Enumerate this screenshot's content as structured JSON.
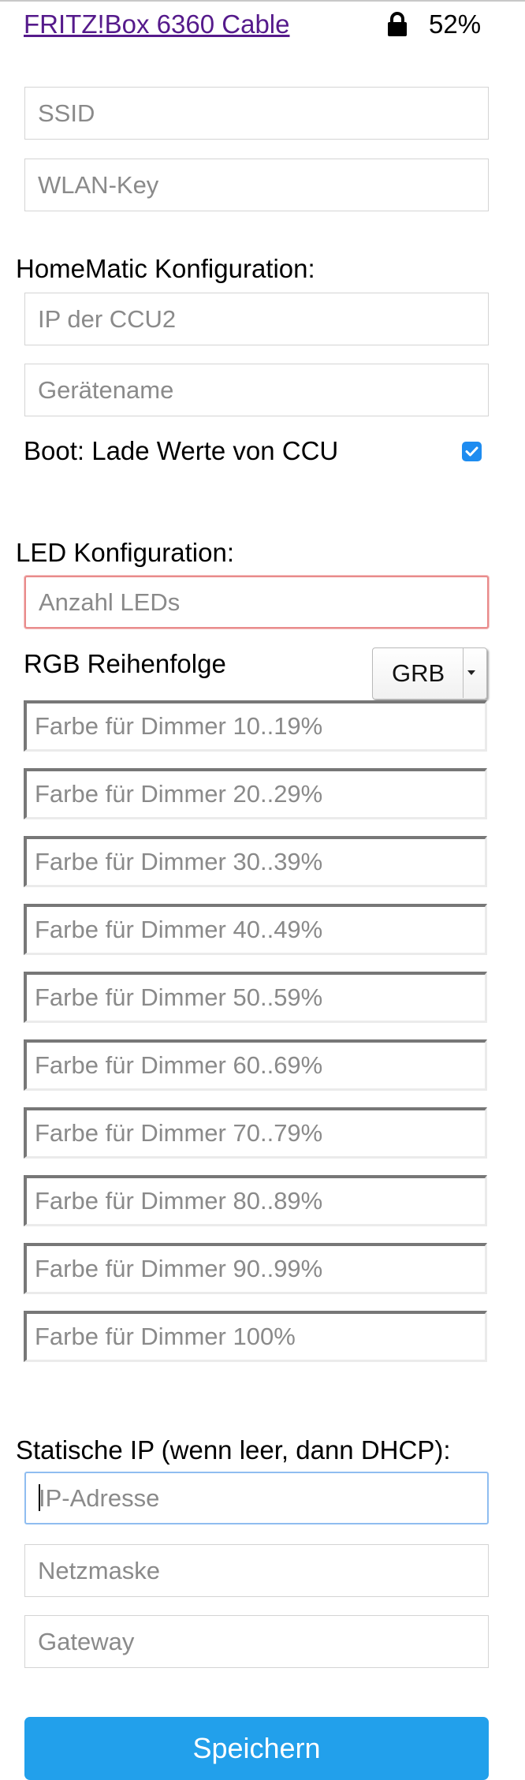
{
  "header": {
    "network_name": "FRITZ!Box 6360 Cable",
    "lock_icon": "lock-icon",
    "signal_strength": "52%"
  },
  "wifi": {
    "ssid_placeholder": "SSID",
    "key_placeholder": "WLAN-Key"
  },
  "homematic": {
    "heading": "HomeMatic Konfiguration:",
    "ccu_ip_placeholder": "IP der CCU2",
    "device_name_placeholder": "Gerätename",
    "boot_label": "Boot: Lade Werte von CCU",
    "boot_checked": true
  },
  "led": {
    "heading": "LED Konfiguration:",
    "count_placeholder": "Anzahl LEDs",
    "rgb_order_label": "RGB Reihenfolge",
    "rgb_order_value": "GRB",
    "dimmer_colors": [
      "Farbe für Dimmer 10..19%",
      "Farbe für Dimmer 20..29%",
      "Farbe für Dimmer 30..39%",
      "Farbe für Dimmer 40..49%",
      "Farbe für Dimmer 50..59%",
      "Farbe für Dimmer 60..69%",
      "Farbe für Dimmer 70..79%",
      "Farbe für Dimmer 80..89%",
      "Farbe für Dimmer 90..99%",
      "Farbe für Dimmer 100%"
    ]
  },
  "static_ip": {
    "heading": "Statische IP (wenn leer, dann DHCP):",
    "ip_placeholder": "IP-Adresse",
    "netmask_placeholder": "Netzmaske",
    "gateway_placeholder": "Gateway"
  },
  "save_label": "Speichern",
  "colors": {
    "accent": "#22a0eb",
    "link": "#551a8b",
    "error_border": "#e98b8b",
    "focus_border": "#8fbdf0",
    "checkbox": "#1e8cf0"
  }
}
